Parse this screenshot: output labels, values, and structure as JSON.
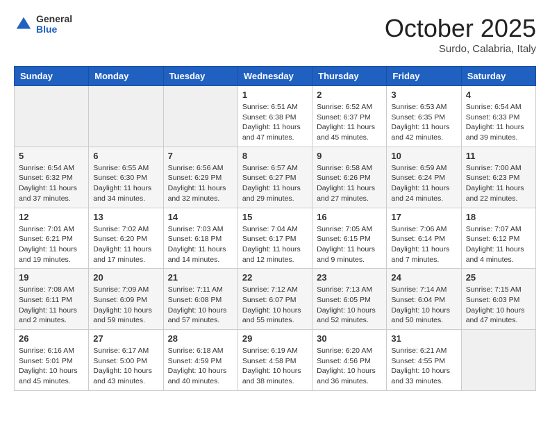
{
  "header": {
    "logo": {
      "general": "General",
      "blue": "Blue"
    },
    "title": "October 2025",
    "subtitle": "Surdo, Calabria, Italy"
  },
  "days_of_week": [
    "Sunday",
    "Monday",
    "Tuesday",
    "Wednesday",
    "Thursday",
    "Friday",
    "Saturday"
  ],
  "weeks": [
    {
      "days": [
        {
          "num": "",
          "info": ""
        },
        {
          "num": "",
          "info": ""
        },
        {
          "num": "",
          "info": ""
        },
        {
          "num": "1",
          "info": "Sunrise: 6:51 AM\nSunset: 6:38 PM\nDaylight: 11 hours and 47 minutes."
        },
        {
          "num": "2",
          "info": "Sunrise: 6:52 AM\nSunset: 6:37 PM\nDaylight: 11 hours and 45 minutes."
        },
        {
          "num": "3",
          "info": "Sunrise: 6:53 AM\nSunset: 6:35 PM\nDaylight: 11 hours and 42 minutes."
        },
        {
          "num": "4",
          "info": "Sunrise: 6:54 AM\nSunset: 6:33 PM\nDaylight: 11 hours and 39 minutes."
        }
      ]
    },
    {
      "days": [
        {
          "num": "5",
          "info": "Sunrise: 6:54 AM\nSunset: 6:32 PM\nDaylight: 11 hours and 37 minutes."
        },
        {
          "num": "6",
          "info": "Sunrise: 6:55 AM\nSunset: 6:30 PM\nDaylight: 11 hours and 34 minutes."
        },
        {
          "num": "7",
          "info": "Sunrise: 6:56 AM\nSunset: 6:29 PM\nDaylight: 11 hours and 32 minutes."
        },
        {
          "num": "8",
          "info": "Sunrise: 6:57 AM\nSunset: 6:27 PM\nDaylight: 11 hours and 29 minutes."
        },
        {
          "num": "9",
          "info": "Sunrise: 6:58 AM\nSunset: 6:26 PM\nDaylight: 11 hours and 27 minutes."
        },
        {
          "num": "10",
          "info": "Sunrise: 6:59 AM\nSunset: 6:24 PM\nDaylight: 11 hours and 24 minutes."
        },
        {
          "num": "11",
          "info": "Sunrise: 7:00 AM\nSunset: 6:23 PM\nDaylight: 11 hours and 22 minutes."
        }
      ]
    },
    {
      "days": [
        {
          "num": "12",
          "info": "Sunrise: 7:01 AM\nSunset: 6:21 PM\nDaylight: 11 hours and 19 minutes."
        },
        {
          "num": "13",
          "info": "Sunrise: 7:02 AM\nSunset: 6:20 PM\nDaylight: 11 hours and 17 minutes."
        },
        {
          "num": "14",
          "info": "Sunrise: 7:03 AM\nSunset: 6:18 PM\nDaylight: 11 hours and 14 minutes."
        },
        {
          "num": "15",
          "info": "Sunrise: 7:04 AM\nSunset: 6:17 PM\nDaylight: 11 hours and 12 minutes."
        },
        {
          "num": "16",
          "info": "Sunrise: 7:05 AM\nSunset: 6:15 PM\nDaylight: 11 hours and 9 minutes."
        },
        {
          "num": "17",
          "info": "Sunrise: 7:06 AM\nSunset: 6:14 PM\nDaylight: 11 hours and 7 minutes."
        },
        {
          "num": "18",
          "info": "Sunrise: 7:07 AM\nSunset: 6:12 PM\nDaylight: 11 hours and 4 minutes."
        }
      ]
    },
    {
      "days": [
        {
          "num": "19",
          "info": "Sunrise: 7:08 AM\nSunset: 6:11 PM\nDaylight: 11 hours and 2 minutes."
        },
        {
          "num": "20",
          "info": "Sunrise: 7:09 AM\nSunset: 6:09 PM\nDaylight: 10 hours and 59 minutes."
        },
        {
          "num": "21",
          "info": "Sunrise: 7:11 AM\nSunset: 6:08 PM\nDaylight: 10 hours and 57 minutes."
        },
        {
          "num": "22",
          "info": "Sunrise: 7:12 AM\nSunset: 6:07 PM\nDaylight: 10 hours and 55 minutes."
        },
        {
          "num": "23",
          "info": "Sunrise: 7:13 AM\nSunset: 6:05 PM\nDaylight: 10 hours and 52 minutes."
        },
        {
          "num": "24",
          "info": "Sunrise: 7:14 AM\nSunset: 6:04 PM\nDaylight: 10 hours and 50 minutes."
        },
        {
          "num": "25",
          "info": "Sunrise: 7:15 AM\nSunset: 6:03 PM\nDaylight: 10 hours and 47 minutes."
        }
      ]
    },
    {
      "days": [
        {
          "num": "26",
          "info": "Sunrise: 6:16 AM\nSunset: 5:01 PM\nDaylight: 10 hours and 45 minutes."
        },
        {
          "num": "27",
          "info": "Sunrise: 6:17 AM\nSunset: 5:00 PM\nDaylight: 10 hours and 43 minutes."
        },
        {
          "num": "28",
          "info": "Sunrise: 6:18 AM\nSunset: 4:59 PM\nDaylight: 10 hours and 40 minutes."
        },
        {
          "num": "29",
          "info": "Sunrise: 6:19 AM\nSunset: 4:58 PM\nDaylight: 10 hours and 38 minutes."
        },
        {
          "num": "30",
          "info": "Sunrise: 6:20 AM\nSunset: 4:56 PM\nDaylight: 10 hours and 36 minutes."
        },
        {
          "num": "31",
          "info": "Sunrise: 6:21 AM\nSunset: 4:55 PM\nDaylight: 10 hours and 33 minutes."
        },
        {
          "num": "",
          "info": ""
        }
      ]
    }
  ]
}
